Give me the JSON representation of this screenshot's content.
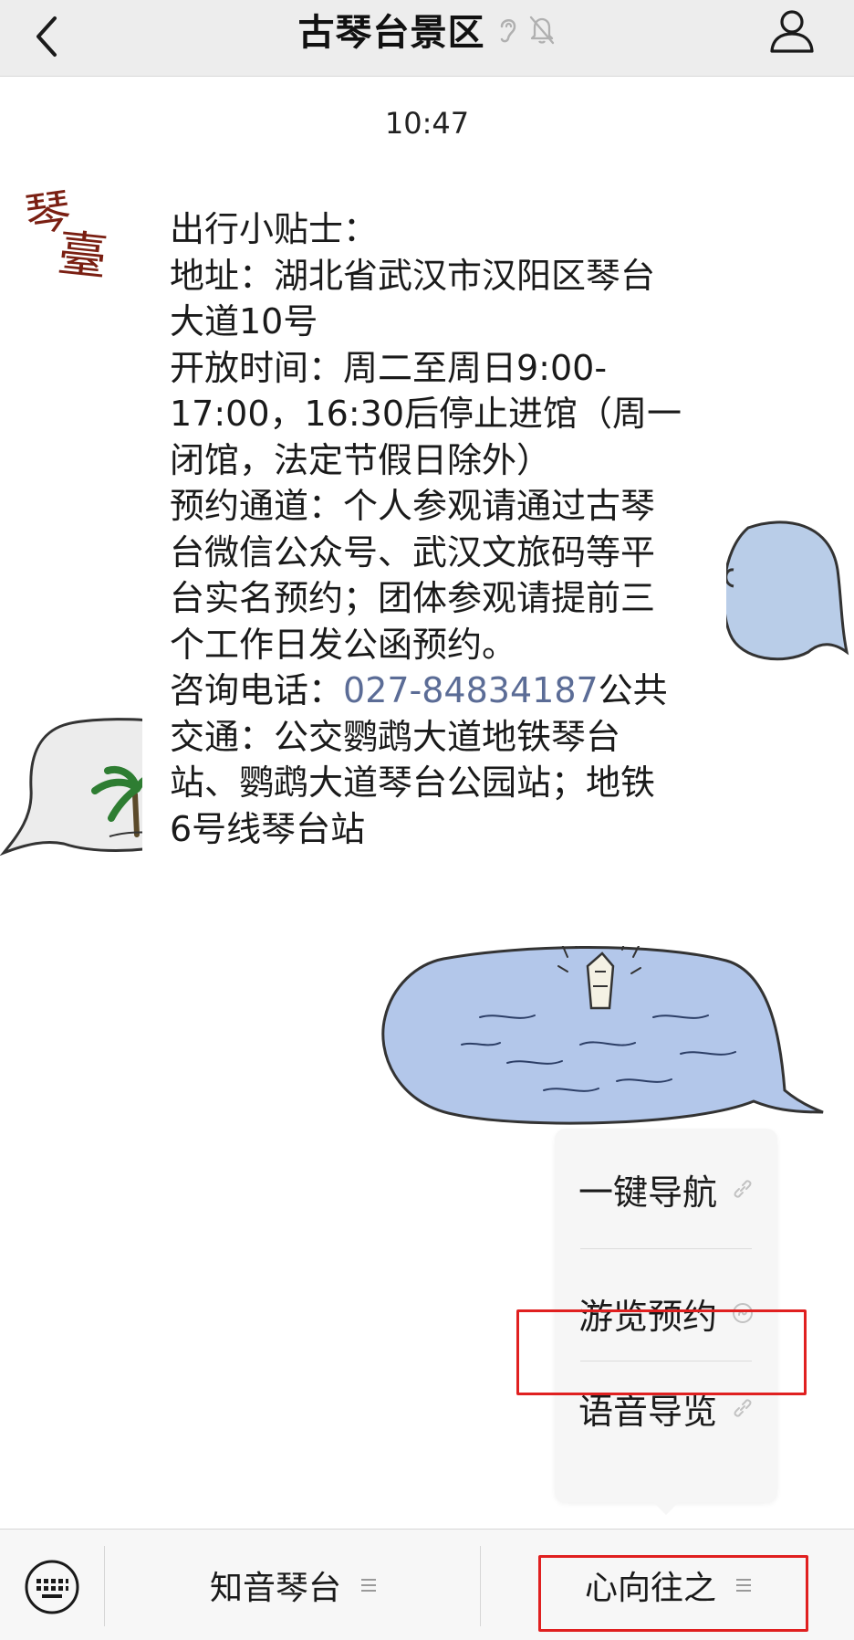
{
  "navbar": {
    "title": "古琴台景区",
    "icons": [
      "back-arrow-icon",
      "ear-icon",
      "mute-bell-icon",
      "profile-icon"
    ]
  },
  "chat": {
    "timestamp": "10:47",
    "avatar_text": "琴臺",
    "message": {
      "lines": [
        "出行小贴士：",
        "地址：湖北省武汉市汉阳区琴台",
        "大道10号",
        "开放时间：周二至周日9:00-",
        "17:00，16:30后停止进馆（周一",
        "闭馆，法定节假日除外）",
        "预约通道：个人参观请通过古琴",
        "台微信公众号、武汉文旅码等平",
        "台实名预约；团体参观请提前三",
        "个工作日发公函预约。"
      ],
      "phone_prefix": "咨询电话：",
      "phone": "027-84834187",
      "phone_suffix": "公共",
      "lines_after": [
        "交通：公交鹦鹉大道地铁琴台",
        "站、鹦鹉大道琴台公园站；地铁",
        "6号线琴台站"
      ]
    }
  },
  "popup_menu": {
    "items": [
      {
        "label": "一键导航",
        "icon": "link-icon"
      },
      {
        "label": "游览预约",
        "icon": "mini-program-icon"
      },
      {
        "label": "语音导览",
        "icon": "link-icon"
      }
    ]
  },
  "bottom_bar": {
    "menus": [
      {
        "label": "知音琴台",
        "icon": "hamburger-icon"
      },
      {
        "label": "心向往之",
        "icon": "hamburger-icon"
      }
    ]
  },
  "colors": {
    "navbar_bg": "#ededed",
    "link_blue": "#5b6c96",
    "highlight_red": "#e02020",
    "bottom_bar_bg": "#f7f7f7"
  }
}
